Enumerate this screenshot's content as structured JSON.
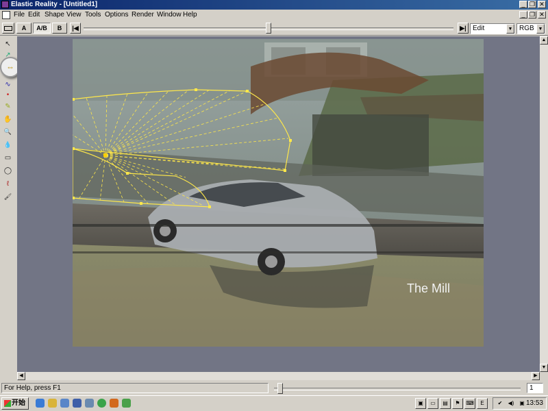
{
  "window": {
    "title": "Elastic Reality - [Untitled1]",
    "minimize": "_",
    "restore": "❐",
    "close": "✕"
  },
  "menu": {
    "items": [
      "File",
      "Edit",
      "Shape",
      "View",
      "Tools",
      "Options",
      "Render",
      "Window",
      "Help"
    ]
  },
  "toolbar": {
    "btn_a": "A",
    "btn_ab": "A/B",
    "btn_b": "B",
    "go_start": "|◀",
    "go_end": "▶|",
    "mode_select": "Edit",
    "color_select": "RGB"
  },
  "tools": [
    {
      "name": "pointer-icon",
      "glyph": "↖"
    },
    {
      "name": "warp-icon",
      "glyph": "↗"
    },
    {
      "name": "transform-icon",
      "glyph": "⇄"
    },
    {
      "name": "bezier-icon",
      "glyph": "∿"
    },
    {
      "name": "node-color-icon",
      "glyph": "•"
    },
    {
      "name": "pen-icon",
      "glyph": "✎"
    },
    {
      "name": "hand-icon",
      "glyph": "✋"
    },
    {
      "name": "magnify-icon",
      "glyph": "🔍"
    },
    {
      "name": "dropper-icon",
      "glyph": "💧"
    },
    {
      "name": "rectangle-icon",
      "glyph": "▭"
    },
    {
      "name": "ellipse-icon",
      "glyph": "◯"
    },
    {
      "name": "lasso-icon",
      "glyph": "ℓ"
    },
    {
      "name": "brush-icon",
      "glyph": "🖌"
    }
  ],
  "selected_tool": {
    "name": "correspondence-icon",
    "glyph": "⇔"
  },
  "canvas": {
    "watermark": "The Mill"
  },
  "status": {
    "help_text": "For Help, press F1",
    "frame": "1"
  },
  "taskbar": {
    "start_label": "开始",
    "clock": "13:53"
  }
}
